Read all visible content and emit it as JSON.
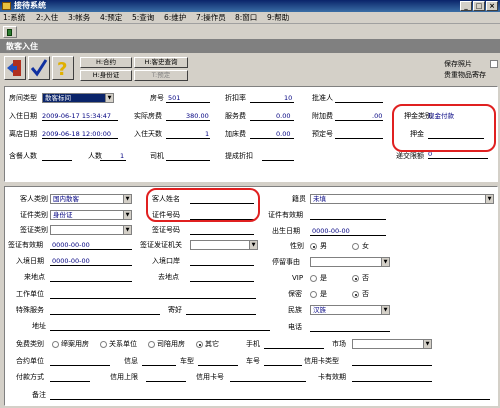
{
  "window": {
    "title": "接待系统"
  },
  "menu": [
    "1:系统",
    "2:入住",
    "3:帐务",
    "4:预定",
    "5:查询",
    "6:维护",
    "7:操作员",
    "8:窗口",
    "9:帮助"
  ],
  "form": {
    "title": "散客入住"
  },
  "actions": {
    "contract": "H:合约",
    "history": "H:客史查询",
    "idcard": "H:身份证",
    "prebook": "T:预定"
  },
  "options": {
    "save_photo": "保存照片",
    "valuables": "贵重物品寄存"
  },
  "room": {
    "room_type_label": "房间类型",
    "room_type": "散客标间",
    "room_no_label": "房号",
    "room_no": "501",
    "discount_label": "折扣率",
    "discount": "10",
    "approver_label": "批准人",
    "checkin_label": "入住日期",
    "checkin": "2009-06-17 15:34:47",
    "actual_price_label": "实际房费",
    "actual_price": "380.00",
    "service_label": "服务费",
    "service": "0.00",
    "extra_label": "附加费",
    "extra": ".00",
    "deposit_type_label": "押金类别",
    "deposit_type": "现金付款",
    "checkout_label": "离店日期",
    "checkout": "2009-06-18 12:00:00",
    "days_label": "入住天数",
    "days": "1",
    "addbed_label": "加床费",
    "addbed": "0.00",
    "booking_label": "预定号",
    "deposit_label": "押金",
    "breakfast_label": "含餐人数",
    "people_label": "人数",
    "people": "1",
    "driver_label": "司机",
    "driver_discount_label": "提成折扣",
    "transfer_label": "递交限额",
    "transfer": "0"
  },
  "guest": {
    "type_label": "客人类别",
    "type": "国内散客",
    "name_label": "客人姓名",
    "origin_label": "籍贯",
    "origin": "未填",
    "id_type_label": "证件类别",
    "id_type": "身份证",
    "id_no_label": "证件号码",
    "id_valid_label": "证件有效期",
    "visa_type_label": "签证类别",
    "visa_no_label": "签证号码",
    "birth_label": "出生日期",
    "birth": "0000-00-00",
    "visa_valid_label": "签证有效期",
    "visa_valid": "0000-00-00",
    "visa_office_label": "签证发证机关",
    "gender_label": "性别",
    "male": "男",
    "female": "女",
    "entry_date_label": "入境日期",
    "entry_date": "0000-00-00",
    "entry_port_label": "入境口岸",
    "stay_reason_label": "停留事由",
    "from_label": "来地点",
    "to_label": "去地点",
    "vip_label": "VIP",
    "yes": "是",
    "no": "否",
    "employer_label": "工作单位",
    "secret_label": "保密",
    "special_label": "特殊服务",
    "message_label": "寄好",
    "nation_label": "民族",
    "nation": "汉族",
    "address_label": "地址",
    "phone_label": "电话",
    "free_label": "免费类别",
    "free_opts": [
      "缔案用房",
      "关系单位",
      "司陪用房",
      "其它"
    ],
    "mobile_label": "手机",
    "market_label": "市场",
    "contract_unit_label": "合约单位",
    "info_label": "信息",
    "car_type_label": "车型",
    "car_no_label": "车号",
    "card_type_label": "信用卡类型",
    "pay_label": "付款方式",
    "credit_limit_label": "信用上限",
    "card_no_label": "信用卡号",
    "card_valid_label": "卡有效期",
    "remark_label": "备注"
  }
}
